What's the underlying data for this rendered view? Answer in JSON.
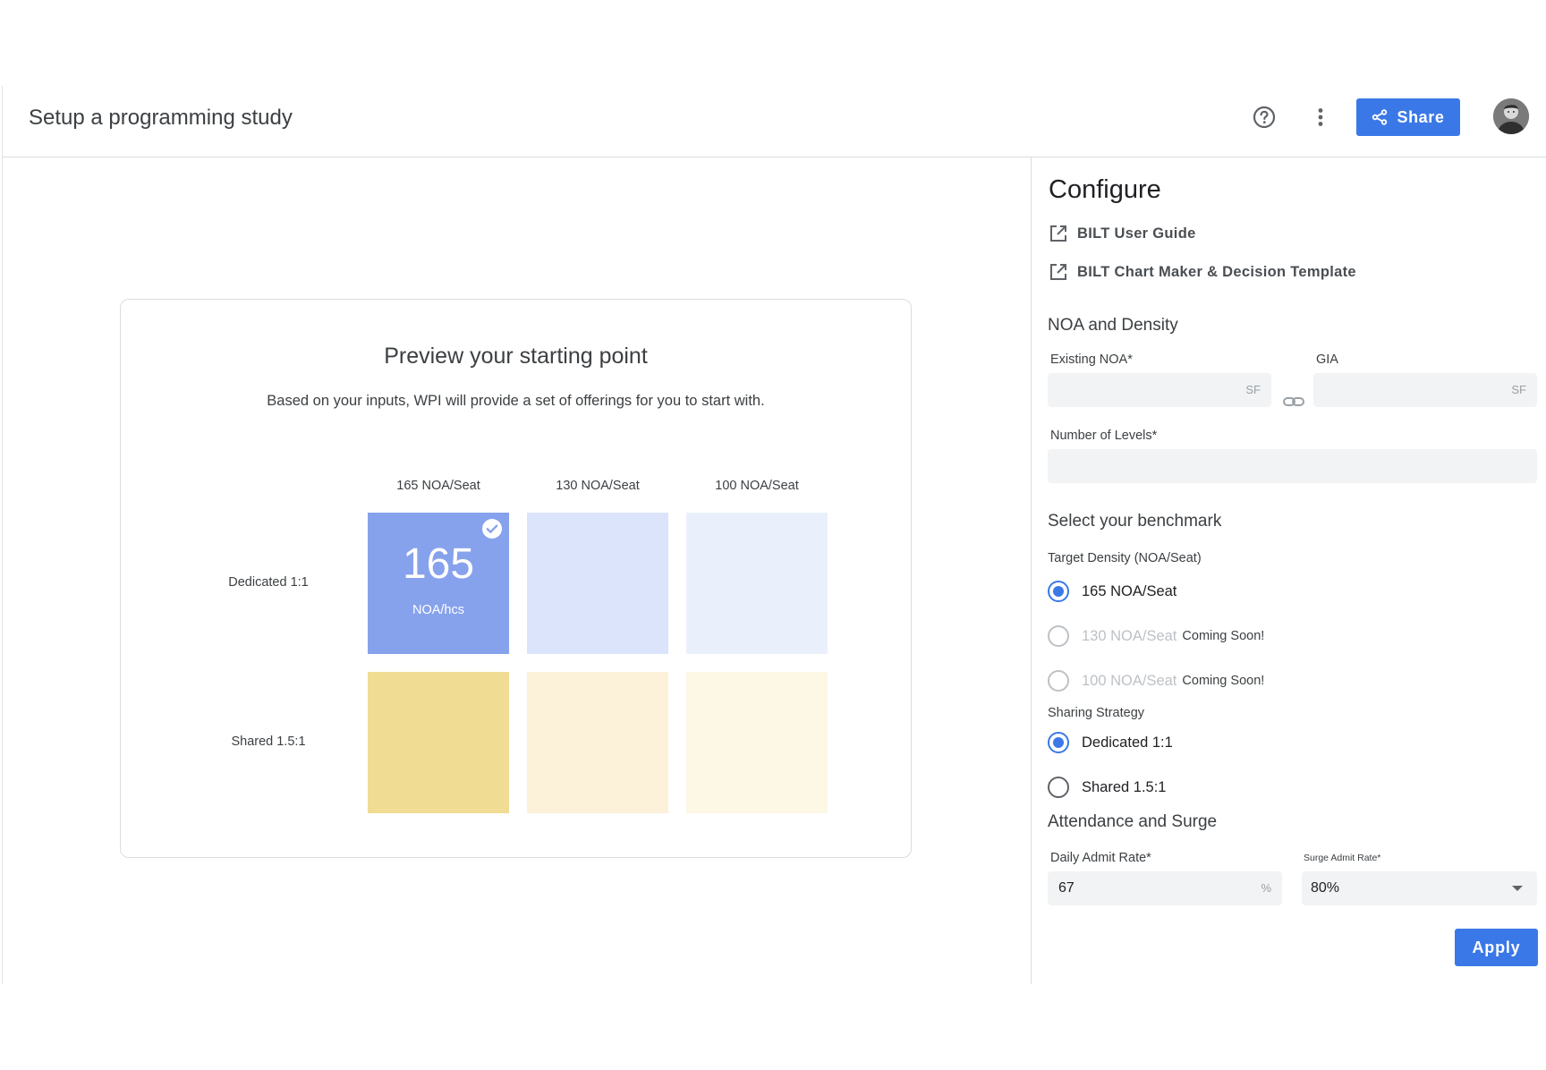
{
  "header": {
    "title": "Setup a programming study",
    "share_label": "Share",
    "help_icon": "help-circle-icon",
    "more_icon": "more-vert-icon",
    "share_icon": "share-icon"
  },
  "preview": {
    "title": "Preview your starting point",
    "subtitle": "Based on your inputs, WPI will provide a set of offerings for you to start with.",
    "columns": [
      "165 NOA/Seat",
      "130 NOA/Seat",
      "100 NOA/Seat"
    ],
    "rows": [
      "Dedicated 1:1",
      "Shared 1.5:1"
    ],
    "selected": {
      "value": "165",
      "unit": "NOA/hcs"
    },
    "colors": {
      "dedicated": [
        "#87a2ec",
        "#dbe4fa",
        "#eaf0fb"
      ],
      "shared": [
        "#f0dc92",
        "#fbf2d9",
        "#fdf7e5"
      ]
    }
  },
  "configure": {
    "title": "Configure",
    "links": [
      "BILT User Guide",
      "BILT Chart Maker & Decision Template"
    ],
    "noa_section": {
      "title": "NOA and Density",
      "existing_noa_label": "Existing NOA*",
      "existing_noa_suffix": "SF",
      "gia_label": "GIA",
      "gia_suffix": "SF",
      "levels_label": "Number of Levels*"
    },
    "benchmark": {
      "title": "Select your benchmark",
      "density_label": "Target Density (NOA/Seat)",
      "density_options": [
        {
          "label": "165 NOA/Seat",
          "note": ""
        },
        {
          "label": "130 NOA/Seat",
          "note": "Coming Soon!"
        },
        {
          "label": "100 NOA/Seat",
          "note": "Coming Soon!"
        }
      ],
      "sharing_label": "Sharing Strategy",
      "sharing_options": [
        "Dedicated 1:1",
        "Shared 1.5:1"
      ]
    },
    "attendance": {
      "title": "Attendance and Surge",
      "daily_label": "Daily Admit Rate*",
      "daily_value": "67",
      "daily_suffix": "%",
      "surge_label": "Surge Admit Rate*",
      "surge_value": "80%"
    },
    "apply_label": "Apply"
  }
}
